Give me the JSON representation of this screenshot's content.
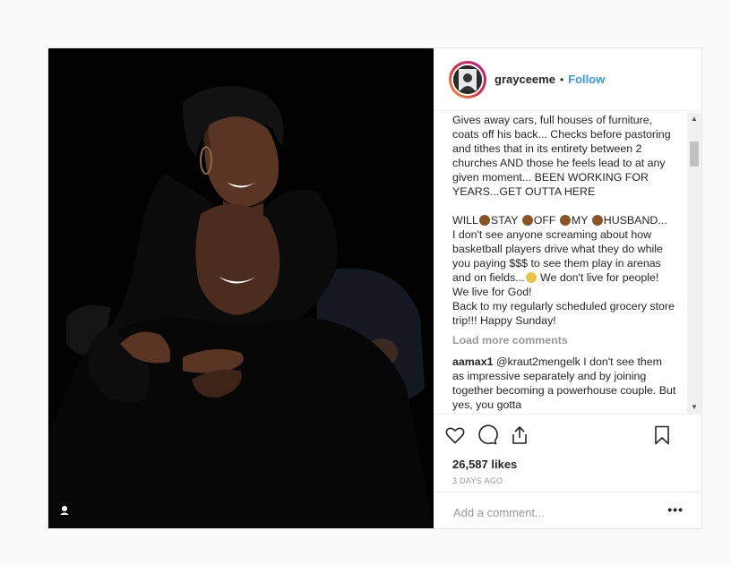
{
  "header": {
    "username": "grayceeme",
    "separator": "•",
    "follow_label": "Follow"
  },
  "caption": {
    "lines_top": "Gives away cars, full houses of furniture, coats off his back... Checks before pastoring and tithes that in its entirety between 2 churches AND those he feels lead to at any given moment... BEEN WORKING FOR YEARS...GET OUTTA HERE",
    "will_line_parts": [
      "WILL",
      "STAY",
      "OFF",
      "MY",
      "HUSBAND..."
    ],
    "body_1": "I don't see anyone screaming about how basketball players drive what they do while you paying $$$ to see them play in arenas and on fields...",
    "body_2": " We don't live for people! We live for God!",
    "body_3": "Back to my regularly scheduled grocery store trip!!! Happy Sunday!"
  },
  "load_more": "Load more comments",
  "comments": [
    {
      "user": "aamax1",
      "text": "@kraut2mengelk I don't see them as impressive separately and by joining together becoming a powerhouse couple. But yes, you gotta"
    }
  ],
  "actions": {
    "like_icon": "heart-icon",
    "comment_icon": "comment-bubble-icon",
    "share_icon": "share-icon",
    "save_icon": "bookmark-icon"
  },
  "likes": "26,587 likes",
  "timestamp": "3 DAYS AGO",
  "add_comment": {
    "placeholder": "Add a comment...",
    "more_label": "•••"
  },
  "colors": {
    "follow": "#3897f0",
    "muted": "#999999",
    "text": "#262626"
  }
}
